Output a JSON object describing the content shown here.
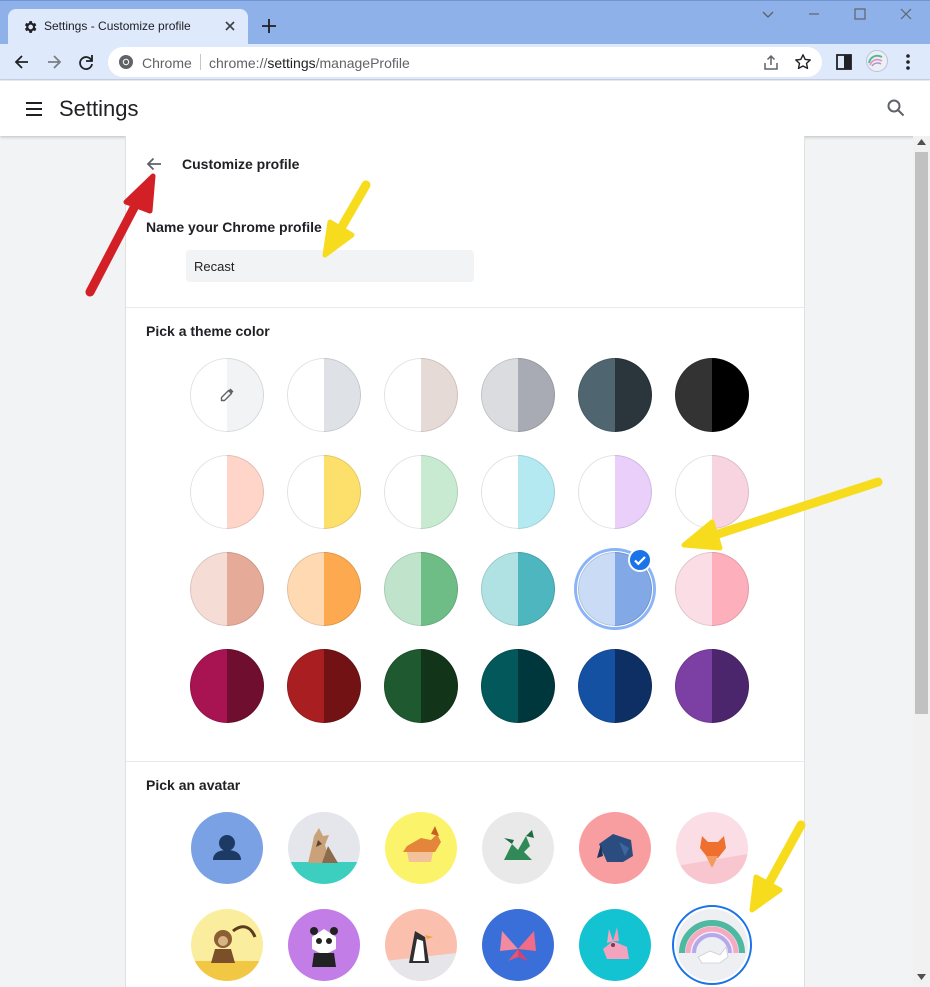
{
  "browser": {
    "tab_title": "Settings - Customize profile",
    "omnibox_chip": "Chrome",
    "url_prefix": "chrome://",
    "url_host": "settings",
    "url_path": "/manageProfile",
    "frame_color": "#8eb1e9",
    "toolbar_color": "#dee9fb"
  },
  "header": {
    "title": "Settings",
    "menu_icon": "hamburger-menu-icon",
    "search_icon": "search-icon"
  },
  "page": {
    "subpage_title": "Customize profile",
    "name_label": "Name your Chrome profile",
    "profile_name": "Recast",
    "theme_label": "Pick a theme color",
    "avatar_label": "Pick an avatar"
  },
  "theme_colors": [
    {
      "name": "custom-color",
      "left": "#ffffff",
      "right": "#f1f3f4",
      "icon": "eyedropper-icon",
      "selected": false
    },
    {
      "name": "default",
      "left": "#ffffff",
      "right": "#dee1e6",
      "selected": false
    },
    {
      "name": "warm-grey",
      "left": "#ffffff",
      "right": "#e6dad6",
      "selected": false
    },
    {
      "name": "cool-grey",
      "left": "#dadce0",
      "right": "#a8abb3",
      "selected": false
    },
    {
      "name": "midnight-blue",
      "left": "#4f6570",
      "right": "#2a363c",
      "selected": false
    },
    {
      "name": "black",
      "left": "#333333",
      "right": "#000000",
      "selected": false
    },
    {
      "name": "beige-white",
      "left": "#ffffff",
      "right": "#fed5c8",
      "selected": false
    },
    {
      "name": "yellow-white",
      "left": "#ffffff",
      "right": "#fde06c",
      "selected": false
    },
    {
      "name": "green-white",
      "left": "#ffffff",
      "right": "#c8ead0",
      "selected": false
    },
    {
      "name": "light-teal-white",
      "left": "#ffffff",
      "right": "#b4e9f1",
      "selected": false
    },
    {
      "name": "light-purple-white",
      "left": "#ffffff",
      "right": "#eacffb",
      "selected": false
    },
    {
      "name": "pink-white",
      "left": "#ffffff",
      "right": "#f8d4e1",
      "selected": false
    },
    {
      "name": "beige",
      "left": "#f5ddd6",
      "right": "#e6aa98",
      "selected": false
    },
    {
      "name": "orange",
      "left": "#fed9b2",
      "right": "#fca94f",
      "selected": false
    },
    {
      "name": "light-green",
      "left": "#c0e4cb",
      "right": "#6fbd86",
      "selected": false
    },
    {
      "name": "light-teal",
      "left": "#b0e1e3",
      "right": "#4db6bf",
      "selected": false
    },
    {
      "name": "light-blue",
      "left": "#cadbf6",
      "right": "#82a8e6",
      "selected": true
    },
    {
      "name": "pink",
      "left": "#fbdde5",
      "right": "#fdafbc",
      "selected": false
    },
    {
      "name": "dark-pink-red",
      "left": "#a71451",
      "right": "#6f0e2f",
      "selected": false
    },
    {
      "name": "dark-red-orange",
      "left": "#a81e21",
      "right": "#721214",
      "selected": false
    },
    {
      "name": "dark-green",
      "left": "#1f592f",
      "right": "#123419",
      "selected": false
    },
    {
      "name": "dark-teal",
      "left": "#02585a",
      "right": "#00373c",
      "selected": false
    },
    {
      "name": "dark-blue",
      "left": "#1551a2",
      "right": "#0d2f63",
      "selected": false
    },
    {
      "name": "purple",
      "left": "#7c3fa3",
      "right": "#4b266c",
      "selected": false
    }
  ],
  "avatars": [
    {
      "name": "generic-person",
      "bg": "#7aa1e4",
      "selected": false
    },
    {
      "name": "origami-cat",
      "bg": "#e4e6ec",
      "selected": false
    },
    {
      "name": "origami-corgi",
      "bg": "#fbf36a",
      "selected": false
    },
    {
      "name": "origami-dragon",
      "bg": "#e8e9e8",
      "selected": false
    },
    {
      "name": "origami-elephant",
      "bg": "#f89ea1",
      "selected": false
    },
    {
      "name": "origami-fox",
      "bg": "#fbdde5",
      "selected": false
    },
    {
      "name": "origami-monkey",
      "bg": "#fbed9e",
      "selected": false
    },
    {
      "name": "origami-panda",
      "bg": "#c37de6",
      "selected": false
    },
    {
      "name": "origami-penguin",
      "bg": "#fbbfae",
      "selected": false
    },
    {
      "name": "origami-butterfly",
      "bg": "#3a6fd9",
      "selected": false
    },
    {
      "name": "origami-rabbit",
      "bg": "#14c3d2",
      "selected": false
    },
    {
      "name": "origami-unicorn",
      "bg": "#edeff2",
      "selected": true
    }
  ],
  "accent_color": "#1a73e8",
  "annotation_arrow_colors": {
    "red": "#d32027",
    "yellow": "#f7dc1e"
  }
}
